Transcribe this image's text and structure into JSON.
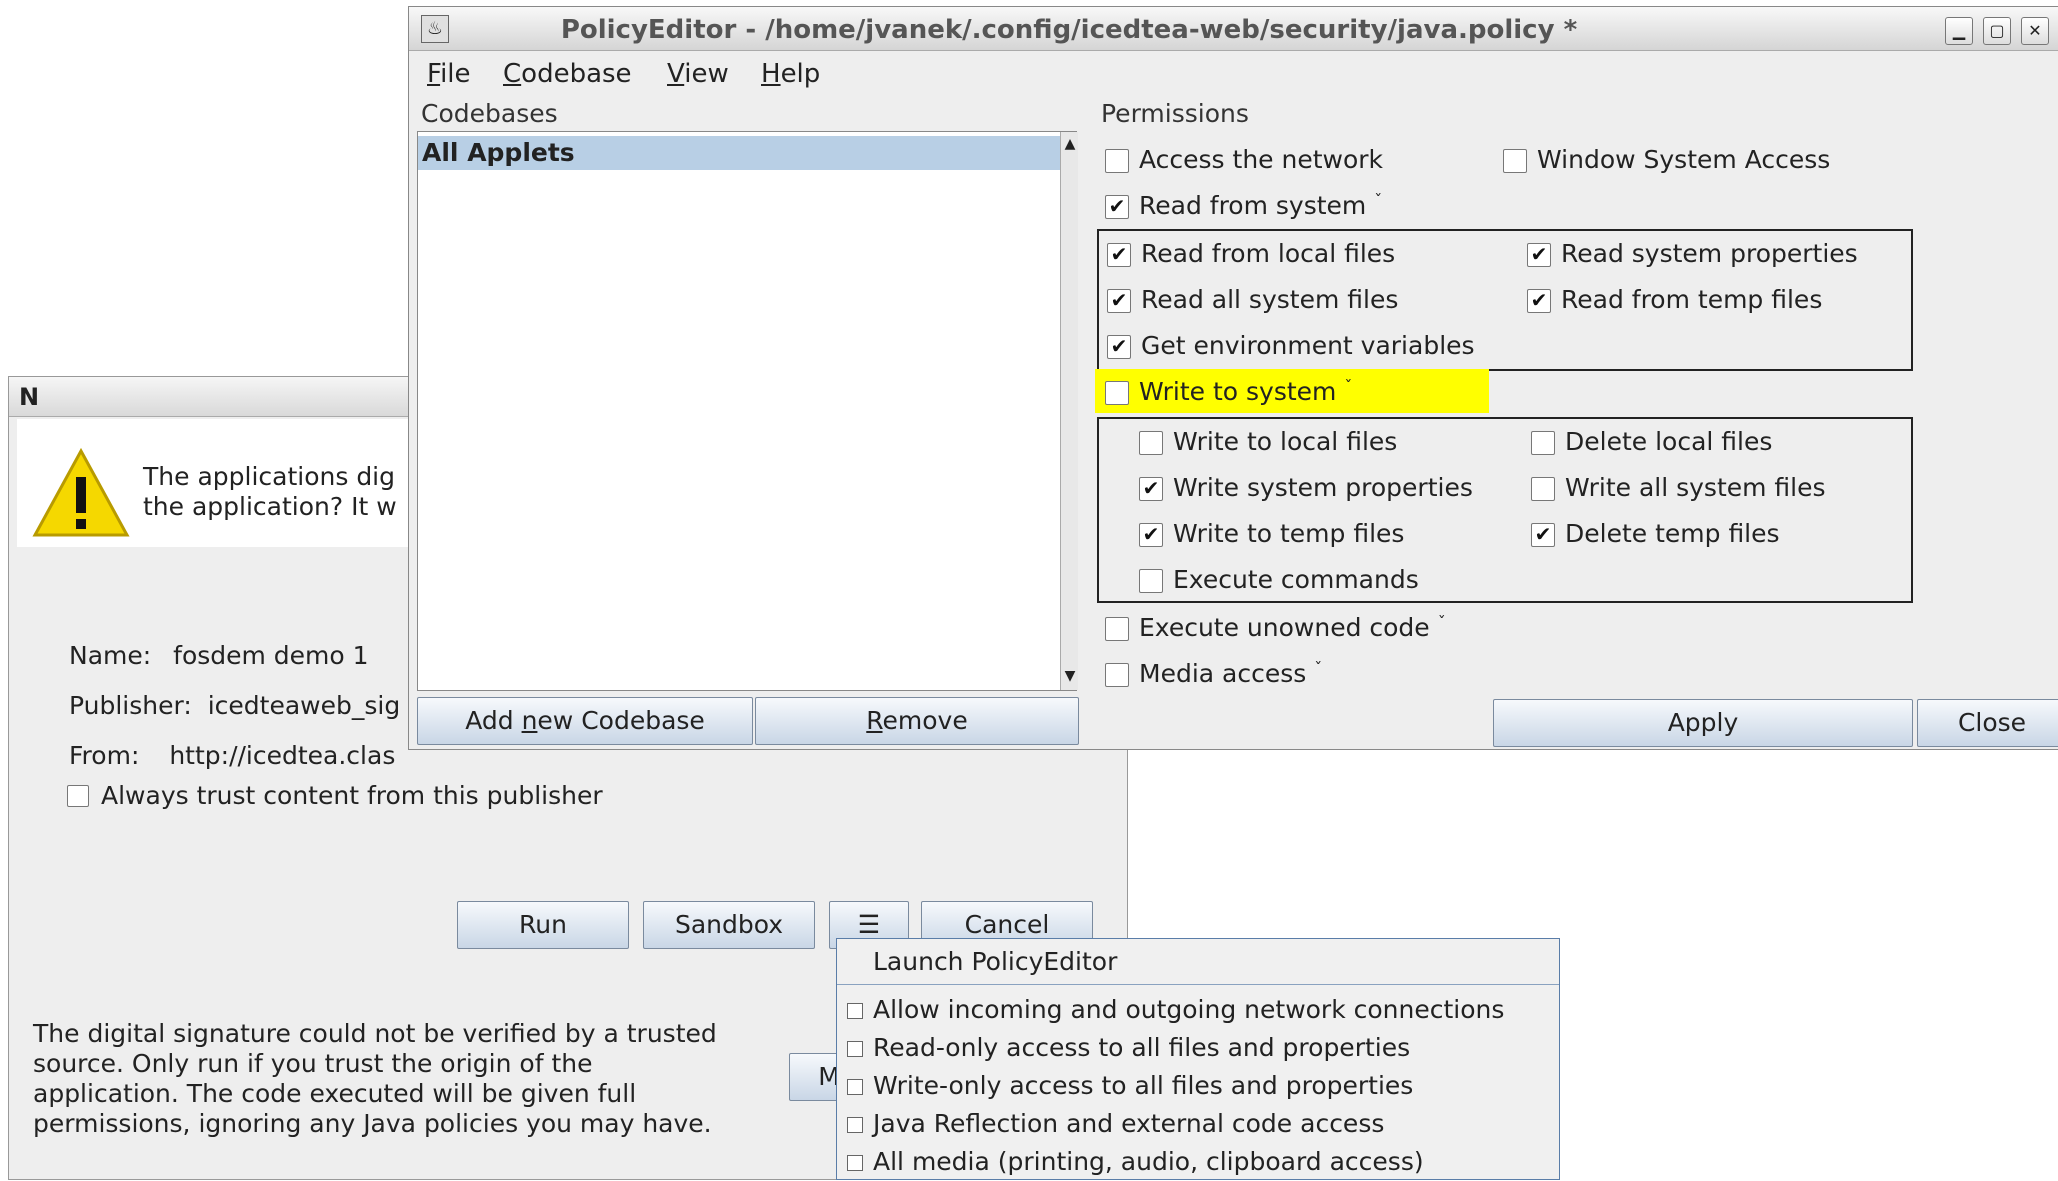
{
  "dialog": {
    "message_line1": "The applications dig",
    "message_line2": "the application? It w",
    "name_label": "Name:",
    "name_value": "fosdem demo 1",
    "publisher_label": "Publisher:",
    "publisher_value": "icedteaweb_sig",
    "from_label": "From:",
    "from_value": "http://icedtea.clas",
    "always_trust": "Always trust content from this publisher",
    "run_button": "Run",
    "sandbox_button": "Sandbox",
    "menu_button": "☰",
    "cancel_button": "Cancel",
    "more_button_partial": "M",
    "bottom_line1": "The digital signature could not be verified by a trusted",
    "bottom_line2": "source. Only run if you trust the origin of the",
    "bottom_line3": "application. The code executed will be given full",
    "bottom_line4": "permissions, ignoring any Java policies you may have."
  },
  "policy_editor": {
    "title": "PolicyEditor - /home/jvanek/.config/icedtea-web/security/java.policy *",
    "menu": {
      "file": {
        "accel": "F",
        "rest": "ile"
      },
      "codebase": {
        "accel": "C",
        "rest": "odebase"
      },
      "view": {
        "accel": "V",
        "rest": "iew"
      },
      "help": {
        "accel": "H",
        "rest": "elp"
      }
    },
    "codebases_label": "Codebases",
    "permissions_label": "Permissions",
    "codebase_items": [
      "All Applets"
    ],
    "add_codebase": {
      "pre": "Add ",
      "accel": "n",
      "post": "ew Codebase"
    },
    "remove": {
      "accel": "R",
      "post": "emove"
    },
    "apply": "Apply",
    "close": "Close",
    "perms": {
      "access_network": {
        "label": "Access the network",
        "checked": false
      },
      "window_system": {
        "label": "Window System Access",
        "checked": false
      },
      "read_from_system": {
        "label": "Read from system",
        "checked": true
      },
      "read_local_files": {
        "label": "Read from local files",
        "checked": true
      },
      "read_system_properties": {
        "label": "Read system properties",
        "checked": true
      },
      "read_all_system_files": {
        "label": "Read all system files",
        "checked": true
      },
      "read_temp_files": {
        "label": "Read from temp files",
        "checked": true
      },
      "get_env": {
        "label": "Get environment variables",
        "checked": true
      },
      "write_to_system": {
        "label": "Write to system",
        "checked": false
      },
      "write_local_files": {
        "label": "Write to local files",
        "checked": false
      },
      "delete_local_files": {
        "label": "Delete local files",
        "checked": false
      },
      "write_system_properties": {
        "label": "Write system properties",
        "checked": true
      },
      "write_all_system_files": {
        "label": "Write all system files",
        "checked": false
      },
      "write_temp_files": {
        "label": "Write to temp files",
        "checked": true
      },
      "delete_temp_files": {
        "label": "Delete temp files",
        "checked": true
      },
      "execute_commands": {
        "label": "Execute commands",
        "checked": false
      },
      "execute_unowned": {
        "label": "Execute unowned code",
        "checked": false
      },
      "media_access": {
        "label": "Media access",
        "checked": false
      }
    },
    "caret": "ˇ",
    "check_mark": "✔"
  },
  "popup": {
    "launch": "Launch PolicyEditor",
    "items": [
      "Allow incoming and outgoing network connections",
      "Read-only access to all files and properties",
      "Write-only access to all files and properties",
      "Java Reflection and external code access",
      "All media (printing, audio, clipboard access)"
    ]
  },
  "colors": {
    "highlight": "#ffff00",
    "selection": "#b8cfe5",
    "warning": "#f5d800"
  }
}
